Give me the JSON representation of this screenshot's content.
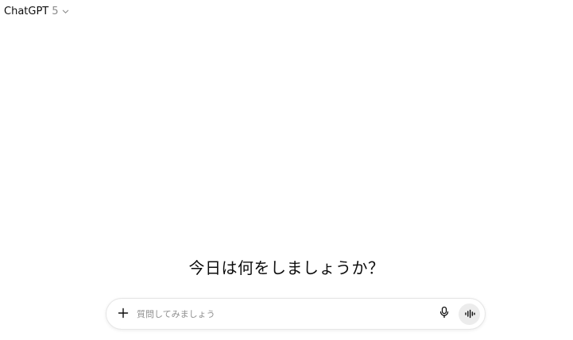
{
  "header": {
    "model_name": "ChatGPT",
    "model_version": "5",
    "switcher_icon": "chevron-down-icon"
  },
  "main": {
    "headline": "今日は何をしましょうか？"
  },
  "composer": {
    "placeholder": "質問してみましょう",
    "value": "",
    "add_icon": "plus-icon",
    "mic_icon": "microphone-icon",
    "voice_icon": "voice-waveform-icon"
  },
  "colors": {
    "background": "#ffffff",
    "text": "#0d0d0d",
    "muted": "#8a8a8a",
    "voice_button_bg": "#ececec"
  }
}
